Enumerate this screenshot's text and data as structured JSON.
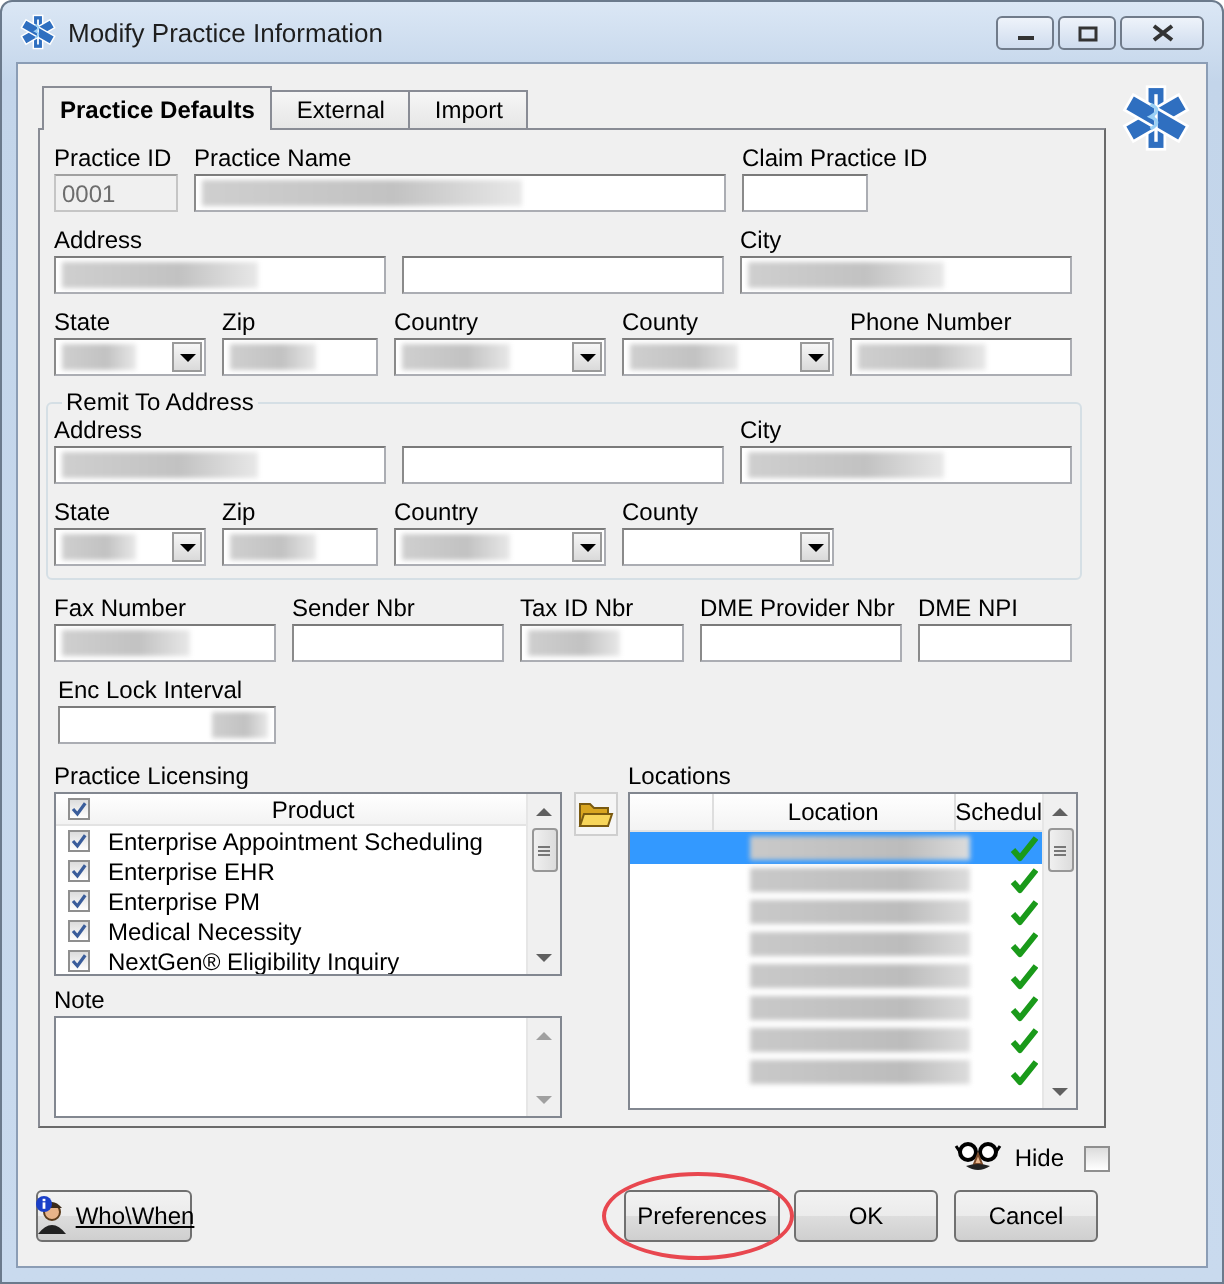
{
  "window": {
    "title": "Modify Practice Information"
  },
  "tabs": [
    {
      "label": "Practice Defaults",
      "selected": true
    },
    {
      "label": "External",
      "selected": false
    },
    {
      "label": "Import",
      "selected": false
    }
  ],
  "practice": {
    "rows": [
      [
        {
          "label": "Practice ID",
          "kind": "text",
          "value": "0001",
          "disabled": true,
          "redacted": false
        },
        {
          "label": "Practice Name",
          "kind": "text",
          "disabled": false,
          "redacted": true
        },
        {
          "label": "Claim Practice ID",
          "kind": "text",
          "disabled": false,
          "redacted": false
        }
      ],
      [
        {
          "label": "Address",
          "kind": "text",
          "disabled": false,
          "redacted": true
        },
        {
          "kind": "text",
          "disabled": false,
          "redacted": false
        },
        {
          "label": "City",
          "kind": "text",
          "disabled": false,
          "redacted": true
        }
      ],
      [
        {
          "label": "State",
          "kind": "combo",
          "disabled": false,
          "redacted": true
        },
        {
          "label": "Zip",
          "kind": "text",
          "disabled": false,
          "redacted": true
        },
        {
          "label": "Country",
          "kind": "combo",
          "disabled": false,
          "redacted": true
        },
        {
          "label": "County",
          "kind": "combo",
          "disabled": false,
          "redacted": true
        },
        {
          "label": "Phone Number",
          "kind": "text",
          "disabled": false,
          "redacted": true
        }
      ]
    ]
  },
  "remit_to_address": {
    "title": "Remit To Address",
    "rows": [
      [
        {
          "label": "Address",
          "kind": "text",
          "disabled": false,
          "redacted": true
        },
        {
          "kind": "text",
          "disabled": false,
          "redacted": false
        },
        {
          "label": "City",
          "kind": "text",
          "disabled": false,
          "redacted": true
        }
      ],
      [
        {
          "label": "State",
          "kind": "combo",
          "disabled": false,
          "redacted": true
        },
        {
          "label": "Zip",
          "kind": "text",
          "disabled": false,
          "redacted": true
        },
        {
          "label": "Country",
          "kind": "combo",
          "disabled": false,
          "redacted": true
        },
        {
          "label": "County",
          "kind": "combo",
          "disabled": false,
          "redacted": false
        }
      ]
    ]
  },
  "identifiers": [
    {
      "label": "Fax Number",
      "kind": "text",
      "disabled": false,
      "redacted": true
    },
    {
      "label": "Sender Nbr",
      "kind": "text",
      "disabled": false,
      "redacted": false
    },
    {
      "label": "Tax ID Nbr",
      "kind": "text",
      "disabled": false,
      "redacted": true
    },
    {
      "label": "DME Provider Nbr",
      "kind": "text",
      "disabled": false,
      "redacted": false
    },
    {
      "label": "DME NPI",
      "kind": "text",
      "disabled": false,
      "redacted": false
    }
  ],
  "enc_lock_interval": {
    "label": "Enc Lock Interval",
    "kind": "number",
    "disabled": false,
    "redacted": true
  },
  "practice_licensing": {
    "title": "Practice Licensing",
    "header_checked": true,
    "column": "Product",
    "rows": [
      {
        "product": "Enterprise Appointment Scheduling",
        "checked": true
      },
      {
        "product": "Enterprise EHR",
        "checked": true
      },
      {
        "product": "Enterprise PM",
        "checked": true
      },
      {
        "product": "Medical Necessity",
        "checked": true
      },
      {
        "product": "NextGen® Eligibility Inquiry",
        "checked": true
      }
    ]
  },
  "note": {
    "label": "Note"
  },
  "locations": {
    "title": "Locations",
    "columns": [
      "Location",
      "Schedul"
    ],
    "rows": [
      {
        "selected": true,
        "scheduled": true
      },
      {
        "selected": false,
        "scheduled": true
      },
      {
        "selected": false,
        "scheduled": true
      },
      {
        "selected": false,
        "scheduled": true
      },
      {
        "selected": false,
        "scheduled": true
      },
      {
        "selected": false,
        "scheduled": true
      },
      {
        "selected": false,
        "scheduled": true
      },
      {
        "selected": false,
        "scheduled": true
      }
    ]
  },
  "hide": {
    "label": "Hide",
    "checked": false
  },
  "buttons": [
    {
      "label": "Who\\When",
      "kind": "who_when",
      "highlighted": false
    },
    {
      "label": "Preferences",
      "kind": "normal",
      "highlighted": true
    },
    {
      "label": "OK",
      "kind": "normal",
      "highlighted": false
    },
    {
      "label": "Cancel",
      "kind": "normal",
      "highlighted": false
    }
  ]
}
